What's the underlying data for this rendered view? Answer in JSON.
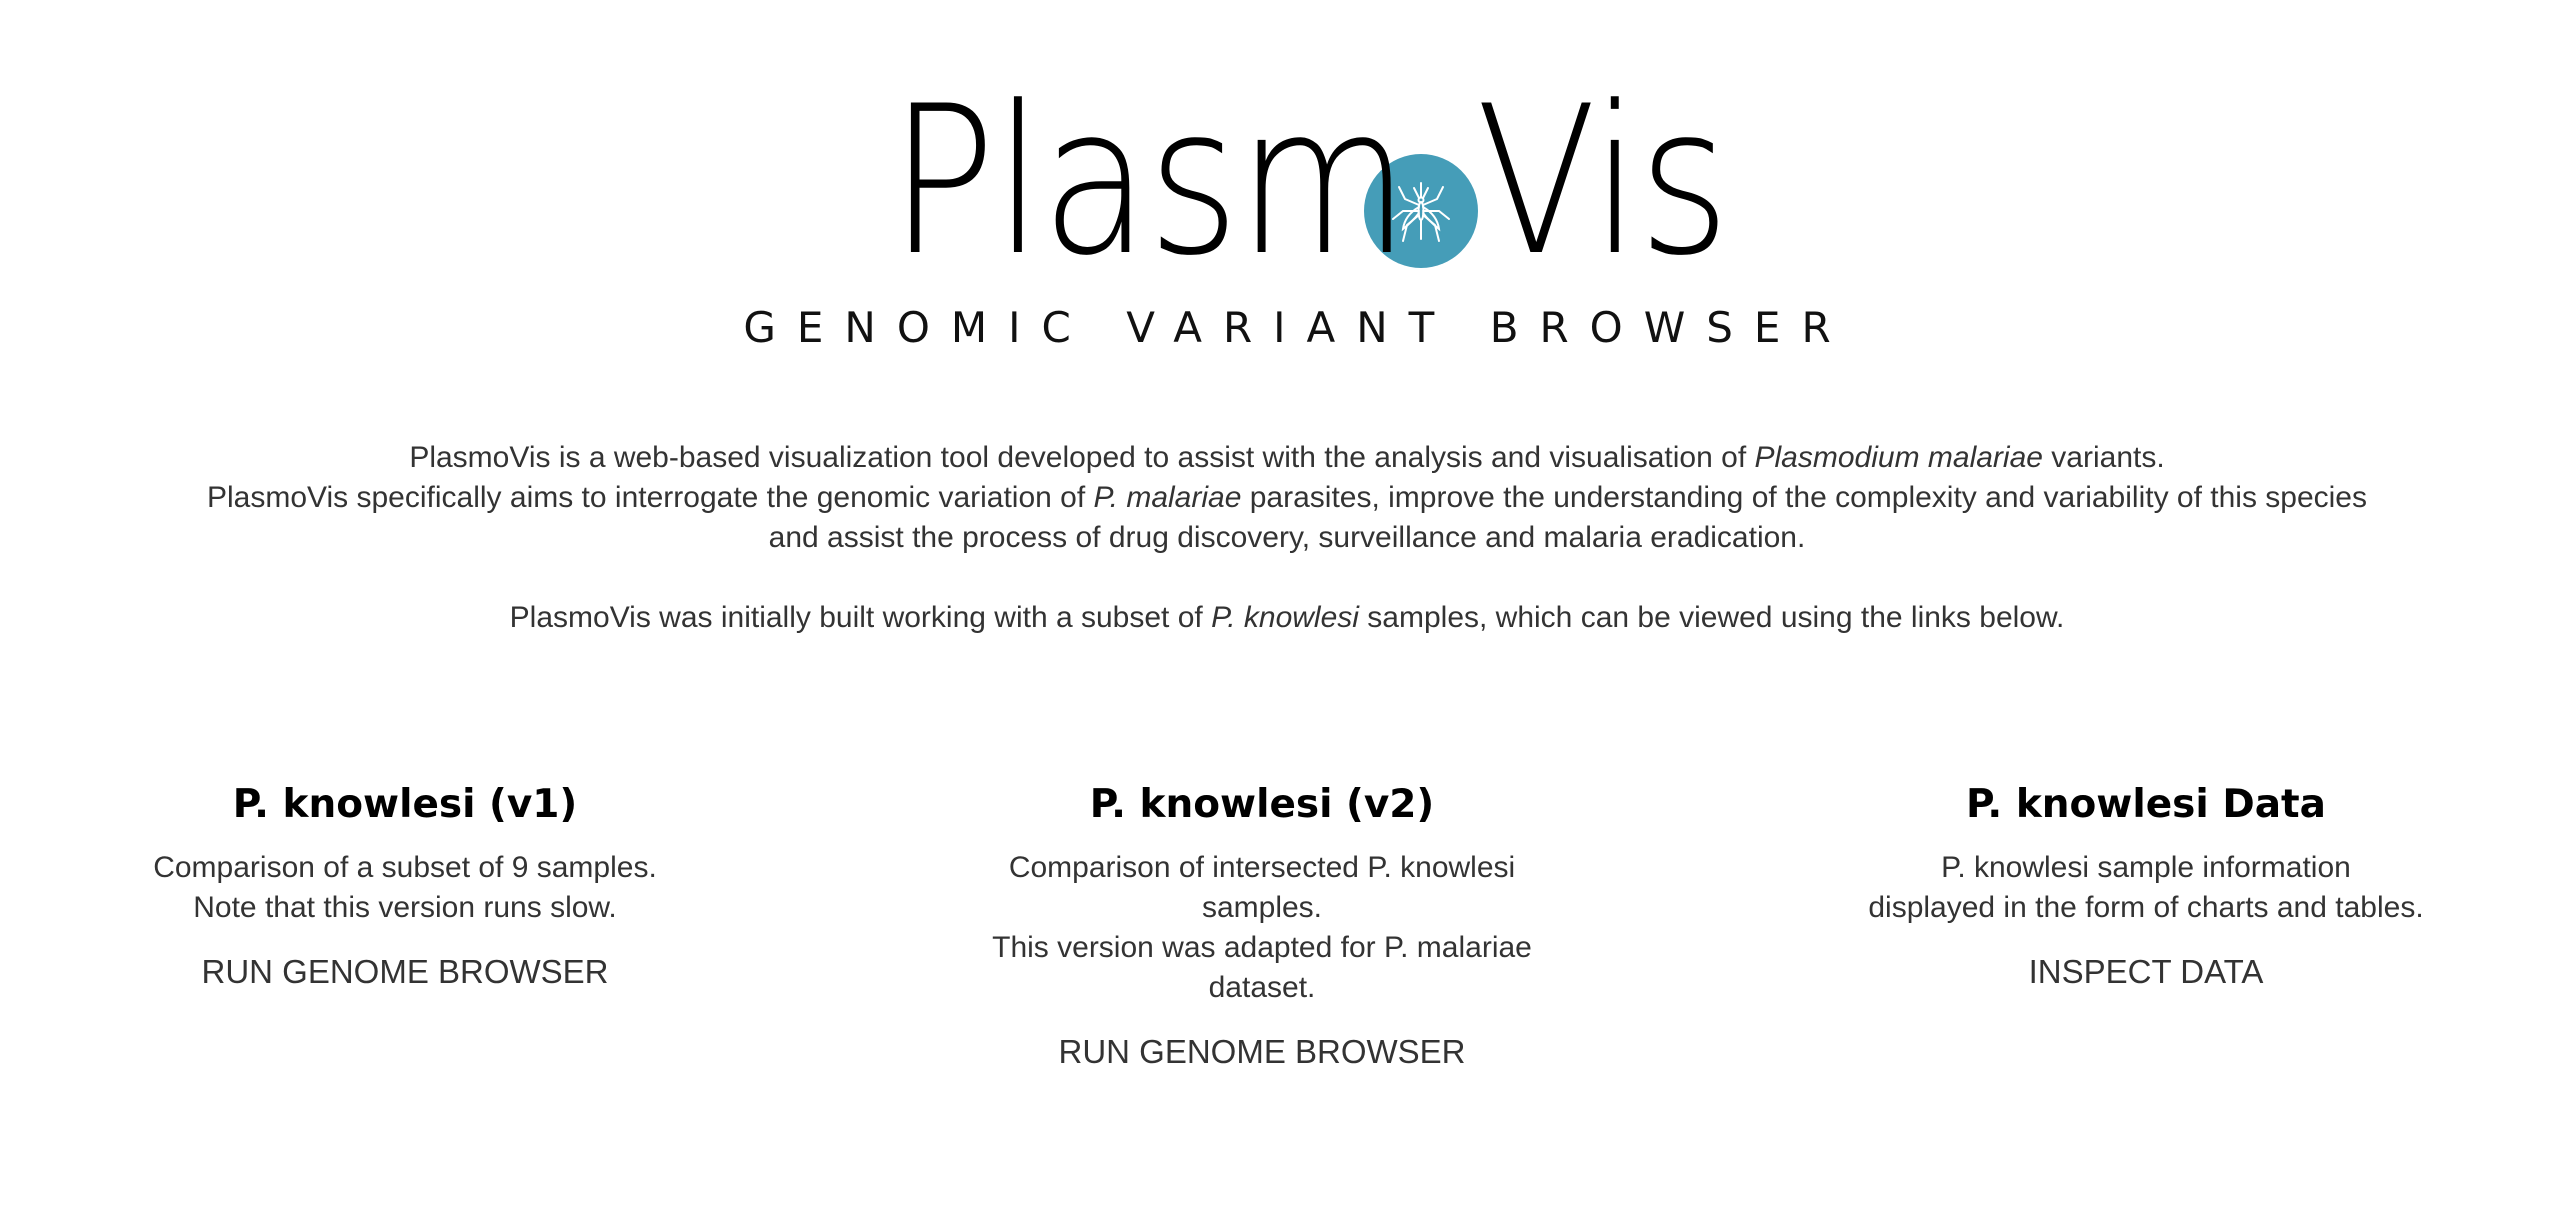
{
  "logo": {
    "title_left": "Plasm",
    "title_right": "Vis",
    "subtitle": "GENOMIC VARIANT BROWSER",
    "circle_color": "#459db8",
    "icon": "mosquito-icon"
  },
  "intro": {
    "line1_a": "PlasmoVis is a web-based visualization tool developed to assist with the analysis and visualisation of ",
    "line1_em": "Plasmodium malariae",
    "line1_b": " variants.",
    "line2_a": "PlasmoVis specifically aims to interrogate the genomic variation of ",
    "line2_em": "P. malariae",
    "line2_b": " parasites, improve the understanding of the complexity and variability of this species",
    "line3": "and assist the process of drug discovery, surveillance and malaria eradication.",
    "line4_a": "PlasmoVis was initially built working with a subset of ",
    "line4_em": "P. knowlesi",
    "line4_b": " samples, which can be viewed using the links below."
  },
  "cards": [
    {
      "title": "P. knowlesi (v1)",
      "desc_line1": "Comparison of a subset of 9 samples.",
      "desc_line2": "Note that this version runs slow.",
      "action": "RUN GENOME BROWSER"
    },
    {
      "title": "P. knowlesi (v2)",
      "desc_line1": "Comparison of intersected P. knowlesi samples.",
      "desc_line2": "This version was adapted for P. malariae dataset.",
      "action": "RUN GENOME BROWSER"
    },
    {
      "title": "P. knowlesi Data",
      "desc_line1": "P. knowlesi sample information",
      "desc_line2": "displayed in the form of charts and tables.",
      "action": "INSPECT DATA"
    }
  ]
}
